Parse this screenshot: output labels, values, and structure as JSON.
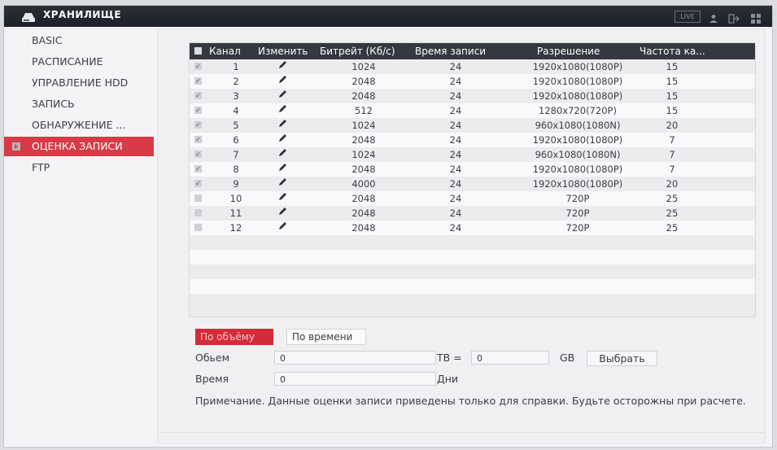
{
  "app": {
    "title": "ХРАНИЛИЩЕ",
    "live_label": "LIVE"
  },
  "sidebar": {
    "items": [
      {
        "label": "BASIC"
      },
      {
        "label": "РАСПИСАНИЕ"
      },
      {
        "label": "УПРАВЛЕНИЕ HDD"
      },
      {
        "label": "ЗАПИСЬ"
      },
      {
        "label": "ОБНАРУЖЕНИЕ ..."
      },
      {
        "label": "ОЦЕНКА ЗАПИСИ",
        "active": true
      },
      {
        "label": "FTP"
      }
    ]
  },
  "table": {
    "headers": {
      "channel": "Канал",
      "edit": "Изменить",
      "bitrate": "Битрейт (Кб/с)",
      "record_time": "Время записи",
      "resolution": "Разрешение",
      "framerate": "Частота ка..."
    },
    "rows": [
      {
        "checked": true,
        "channel": "1",
        "bitrate": "1024",
        "record_time": "24",
        "resolution": "1920x1080(1080P)",
        "framerate": "15"
      },
      {
        "checked": true,
        "channel": "2",
        "bitrate": "2048",
        "record_time": "24",
        "resolution": "1920x1080(1080P)",
        "framerate": "15"
      },
      {
        "checked": true,
        "channel": "3",
        "bitrate": "2048",
        "record_time": "24",
        "resolution": "1920x1080(1080P)",
        "framerate": "15"
      },
      {
        "checked": true,
        "channel": "4",
        "bitrate": "512",
        "record_time": "24",
        "resolution": "1280x720(720P)",
        "framerate": "15"
      },
      {
        "checked": true,
        "channel": "5",
        "bitrate": "1024",
        "record_time": "24",
        "resolution": "960x1080(1080N)",
        "framerate": "20"
      },
      {
        "checked": true,
        "channel": "6",
        "bitrate": "2048",
        "record_time": "24",
        "resolution": "1920x1080(1080P)",
        "framerate": "7"
      },
      {
        "checked": true,
        "channel": "7",
        "bitrate": "1024",
        "record_time": "24",
        "resolution": "960x1080(1080N)",
        "framerate": "7"
      },
      {
        "checked": true,
        "channel": "8",
        "bitrate": "2048",
        "record_time": "24",
        "resolution": "1920x1080(1080P)",
        "framerate": "7"
      },
      {
        "checked": true,
        "channel": "9",
        "bitrate": "4000",
        "record_time": "24",
        "resolution": "1920x1080(1080P)",
        "framerate": "20"
      },
      {
        "checked": false,
        "channel": "10",
        "bitrate": "2048",
        "record_time": "24",
        "resolution": "720P",
        "framerate": "25"
      },
      {
        "checked": false,
        "channel": "11",
        "bitrate": "2048",
        "record_time": "24",
        "resolution": "720P",
        "framerate": "25"
      },
      {
        "checked": false,
        "channel": "12",
        "bitrate": "2048",
        "record_time": "24",
        "resolution": "720P",
        "framerate": "25"
      }
    ]
  },
  "tabs": {
    "by_volume": "По объёму",
    "by_time": "По времени"
  },
  "form": {
    "volume_label": "Обьем",
    "volume_value": "0",
    "tb_label": "TB =",
    "tb_value": "0",
    "gb_label": "GB",
    "select_label": "Выбрать",
    "time_label": "Время",
    "time_value": "0",
    "days_label": "Дни"
  },
  "note": "Примечание. Данные оценки записи приведены только для справки. Будьте осторожны при расчете.",
  "colors": {
    "accent": "#d32b3a",
    "header_bg": "#35383f",
    "topbar_bg": "#1d2026"
  }
}
